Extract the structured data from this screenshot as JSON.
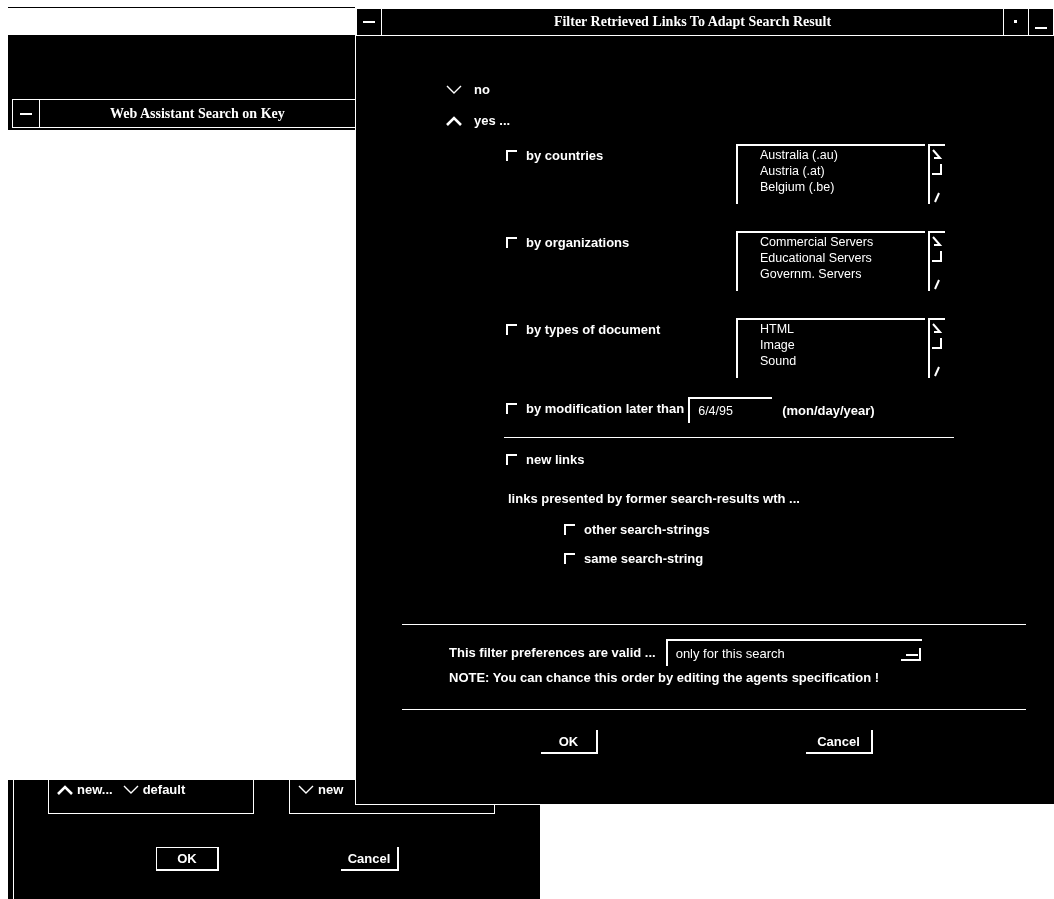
{
  "background_window": {
    "title": "Web Assistant Search on Key",
    "radio_groups": [
      {
        "options": [
          {
            "label": "new...",
            "selected": true
          },
          {
            "label": "default",
            "selected": false
          }
        ]
      },
      {
        "options": [
          {
            "label": "new",
            "selected": false
          }
        ]
      }
    ],
    "buttons": [
      "OK",
      "Cancel"
    ]
  },
  "dialog": {
    "title": "Filter Retrieved Links To Adapt Search Result",
    "mode_options": [
      {
        "label": "no",
        "selected": false
      },
      {
        "label": "yes ...",
        "selected": true
      }
    ],
    "filters": [
      {
        "kind": "list",
        "label": "by countries",
        "checked": false,
        "items": [
          "Australia (.au)",
          "Austria (.at)",
          "Belgium (.be)"
        ]
      },
      {
        "kind": "list",
        "label": "by organizations",
        "checked": false,
        "items": [
          "Commercial Servers",
          "Educational Servers",
          "Governm. Servers"
        ]
      },
      {
        "kind": "list",
        "label": "by types of document",
        "checked": false,
        "items": [
          "HTML",
          "Image",
          "Sound"
        ]
      },
      {
        "kind": "date",
        "label": "by modification later than",
        "checked": false,
        "value": "6/4/95",
        "hint": "(mon/day/year)"
      }
    ],
    "new_links": {
      "label": "new links",
      "checked": false
    },
    "former_label": "links presented by former search-results wth ...",
    "former_options": [
      {
        "label": "other search-strings",
        "checked": false
      },
      {
        "label": "same search-string",
        "checked": false
      }
    ],
    "validity": {
      "label": "This filter preferences are valid ...",
      "value": "only for this search"
    },
    "note": "NOTE: You can chance this order by editing the agents specification !",
    "buttons": [
      "OK",
      "Cancel"
    ]
  }
}
